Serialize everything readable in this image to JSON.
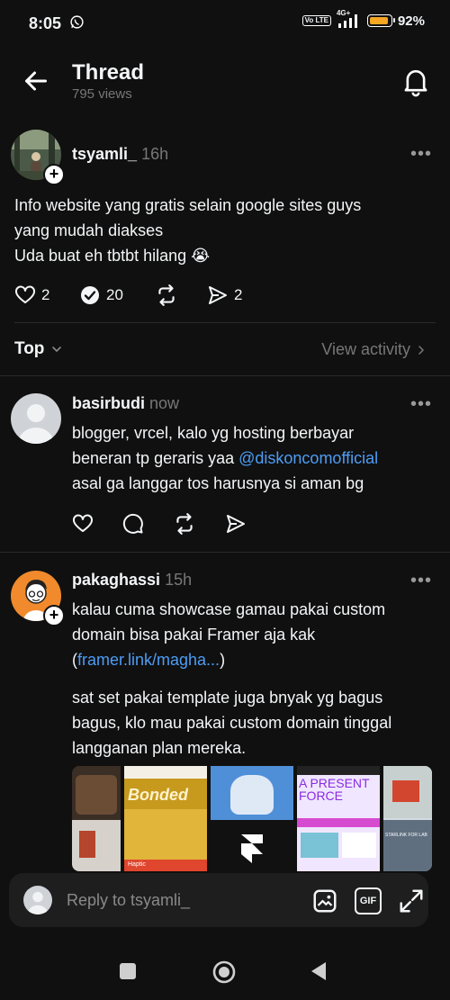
{
  "status_bar": {
    "time": "8:05",
    "network": "4G+",
    "volte": "Vo LTE",
    "battery": "92%",
    "battery_level": 0.92
  },
  "header": {
    "title": "Thread",
    "views": "795 views"
  },
  "original_post": {
    "username": "tsyamli_",
    "time": "16h",
    "lines": [
      "Info website yang gratis selain google sites guys",
      "yang mudah diakses",
      "Uda buat eh tbtbt hilang 😭"
    ],
    "likes": "2",
    "replies": "20",
    "shares": "2"
  },
  "sort": {
    "label": "Top",
    "view_activity": "View activity"
  },
  "reply1": {
    "username": "basirbudi",
    "time": "now",
    "line1": "blogger, vrcel, kalo yg hosting berbayar",
    "line2_text": "beneran tp geraris yaa ",
    "mention": "@diskoncomofficial",
    "line3": "asal ga langgar tos harusnya si aman bg"
  },
  "reply2": {
    "username": "pakaghassi",
    "time": "15h",
    "p1_line1": "kalau cuma showcase gamau pakai custom",
    "p1_line2": "domain bisa pakai Framer aja kak",
    "link_open": "(",
    "link": "framer.link/magha...",
    "link_close": ")",
    "p2_line1": "sat set pakai template juga bnyak yg bagus",
    "p2_line2": "bagus, klo mau pakai custom domain tinggal",
    "p2_line3": "langganan plan mereka.",
    "thumb_texts": [
      "Bonded",
      "A PRESENT FORCE",
      "STARLINK FOR LAB",
      "Haptic"
    ]
  },
  "composer": {
    "placeholder": "Reply to tsyamli_"
  },
  "icons": [
    "back-arrow-icon",
    "bell-icon",
    "heart-icon",
    "repost-check-icon",
    "repost-icon",
    "send-icon",
    "comment-icon",
    "image-icon",
    "gif-icon",
    "expand-icon",
    "more-icon"
  ],
  "colors": {
    "background": "#101010",
    "text": "#f3f5f7",
    "muted": "#777777",
    "link": "#4d9df5",
    "battery": "#f5a623"
  }
}
